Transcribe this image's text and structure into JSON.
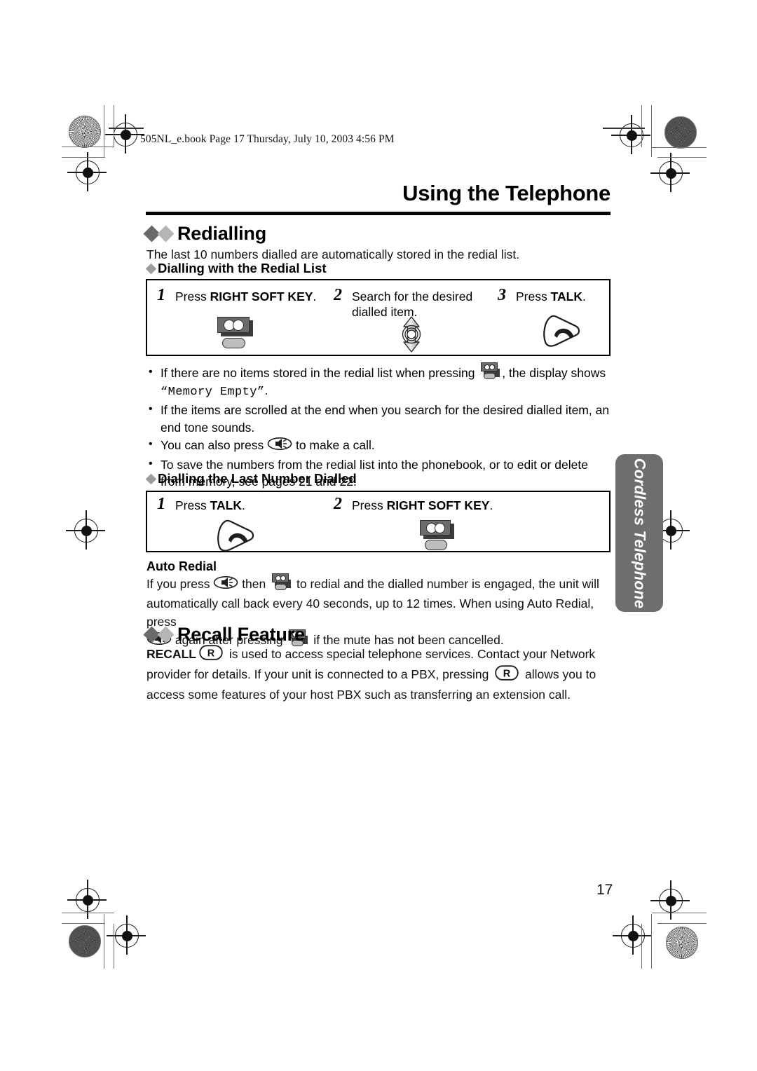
{
  "document": {
    "file_meta": "505NL_e.book  Page 17  Thursday, July 10, 2003  4:56 PM",
    "chapter_title": "Using the Telephone",
    "page_number": "17",
    "side_tab_label": "Cordless Telephone"
  },
  "sections": {
    "redialling": {
      "heading": "Redialling",
      "intro": "The last 10 numbers dialled are automatically stored in the redial list.",
      "sub_heading": "Dialling with the Redial List",
      "steps": [
        {
          "num": "1",
          "text_before": "Press ",
          "text_bold": "RIGHT SOFT KEY",
          "text_after": ".",
          "icon": "soft-key-icon"
        },
        {
          "num": "2",
          "text_before": "Search for the desired dialled item.",
          "text_bold": "",
          "text_after": "",
          "icon": "navigator-icon"
        },
        {
          "num": "3",
          "text_before": "Press ",
          "text_bold": "TALK",
          "text_after": ".",
          "icon": "talk-icon"
        }
      ],
      "notes": [
        {
          "part1": "If there are no items stored in the redial list when pressing ",
          "icon": "soft-key-icon",
          "part2": ", the display shows ",
          "mono": "“Memory Empty”",
          "part3": "."
        },
        {
          "part1": "If the items are scrolled at the end when you search for the desired dialled item, an end tone sounds.",
          "icon": "",
          "part2": "",
          "mono": "",
          "part3": ""
        },
        {
          "part1": "You can also press ",
          "icon": "speakerphone-icon",
          "part2": " to make a call.",
          "mono": "",
          "part3": ""
        },
        {
          "part1": "To save the numbers from the redial list into the phonebook, or to edit or delete from memory, see pages 21 and 22.",
          "icon": "",
          "part2": "",
          "mono": "",
          "part3": ""
        }
      ]
    },
    "last_number": {
      "sub_heading": "Dialling the Last Number Dialled",
      "steps": [
        {
          "num": "1",
          "text_before": "Press ",
          "text_bold": "TALK",
          "text_after": ".",
          "icon": "talk-icon"
        },
        {
          "num": "2",
          "text_before": "Press ",
          "text_bold": "RIGHT SOFT KEY",
          "text_after": ".",
          "icon": "soft-key-icon"
        }
      ]
    },
    "auto_redial": {
      "heading": "Auto Redial",
      "line1_a": "If you press ",
      "line1_icon1": "speakerphone-icon",
      "line1_b": " then ",
      "line1_icon2": "soft-key-icon",
      "line1_c": " to redial and the dialled number is engaged, the unit will",
      "line2": "automatically call back every 40 seconds, up to 12 times. When using Auto Redial, press",
      "line3_icon1": "speakerphone-icon",
      "line3_a": " again after pressing ",
      "line3_icon2": "soft-key-icon",
      "line3_b": " if the mute has not been cancelled."
    },
    "recall": {
      "heading": "Recall Feature",
      "label_bold": "RECALL",
      "key_glyph": "R",
      "line1_after": " is used to access special telephone services. Contact your Network",
      "line2_a": "provider for details. If your unit is connected to a PBX, pressing ",
      "line2_b": " allows you to",
      "line3": "access some features of your host PBX such as transferring an extension call."
    }
  },
  "colors": {
    "diamond_dark": "#6a6a6a",
    "diamond_light": "#b5b5b5",
    "side_tab_bg": "#6e6e6e",
    "soft_key_body": "#6b6b6b",
    "soft_key_pill": "#bdbdbd",
    "text": "#000000"
  }
}
